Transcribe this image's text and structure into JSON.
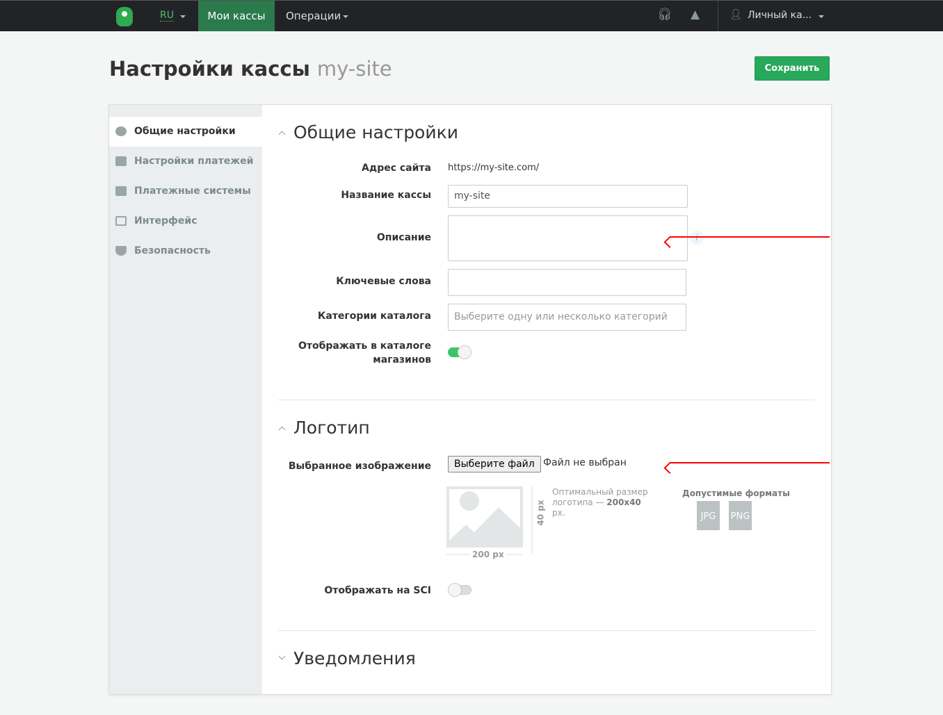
{
  "topbar": {
    "lang": "RU",
    "nav_active": "Мои кассы",
    "nav_operations": "Операции",
    "account": "Личный ка...",
    "icons": [
      "headset-icon",
      "warning-icon",
      "user-icon"
    ]
  },
  "page": {
    "title": "Настройки кассы",
    "site": "my-site",
    "save": "Сохранить"
  },
  "sidebar": {
    "items": [
      {
        "label": "Общие настройки",
        "icon": "gear-icon"
      },
      {
        "label": "Настройки платежей",
        "icon": "card-icon"
      },
      {
        "label": "Платежные системы",
        "icon": "cash-icon"
      },
      {
        "label": "Интерфейс",
        "icon": "windows-icon"
      },
      {
        "label": "Безопасность",
        "icon": "shield-icon"
      }
    ]
  },
  "general": {
    "title": "Общие настройки",
    "site_label": "Адрес сайта",
    "site_value": "https://my-site.com/",
    "name_label": "Название кассы",
    "name_value": "my-site",
    "desc_label": "Описание",
    "keywords_label": "Ключевые слова",
    "categories_label": "Категории каталога",
    "categories_placeholder": "Выберите одну или несколько категорий",
    "show_catalog_label": "Отображать в каталоге магазинов",
    "show_catalog_on": true
  },
  "logo": {
    "title": "Логотип",
    "image_label": "Выбранное изображение",
    "file_button": "Выберите файл",
    "file_status": "Файл не выбран",
    "width": "200 px",
    "height": "40 px",
    "hint_prefix": "Оптимальный размер логотипа —",
    "hint_size": "200x40",
    "hint_suffix": "px.",
    "formats_title": "Допустимые форматы",
    "formats": [
      "JPG",
      "PNG"
    ],
    "sci_label": "Отображать на SCI",
    "sci_on": false
  },
  "notifications": {
    "title": "Уведомления"
  }
}
